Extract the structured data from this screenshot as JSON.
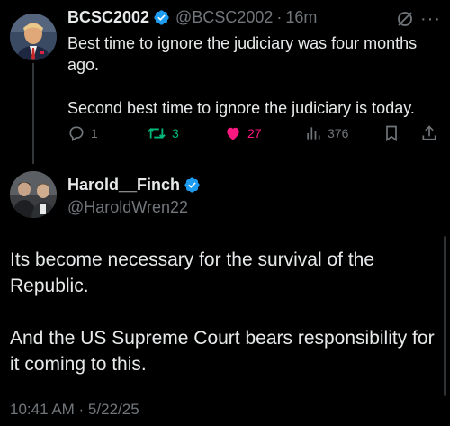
{
  "parent_tweet": {
    "display_name": "BCSC2002",
    "handle": "@BCSC2002",
    "separator": "·",
    "time": "16m",
    "paragraphs": [
      "Best time to ignore the judiciary was four months ago.",
      "Second best time to ignore the judiciary is today."
    ],
    "actions": {
      "reply_count": "1",
      "retweet_count": "3",
      "like_count": "27",
      "view_count": "376"
    },
    "icons": [
      "verified-badge-icon",
      "grok-icon",
      "more-icon",
      "reply-icon",
      "retweet-icon",
      "heart-icon",
      "views-icon",
      "bookmark-icon",
      "share-icon"
    ]
  },
  "main_tweet": {
    "display_name": "Harold__Finch",
    "handle": "@HaroldWren22",
    "paragraphs": [
      "Its become necessary for the survival of the Republic.",
      "And the US Supreme Court bears responsibility for it coming to this."
    ],
    "timestamp": "10:41 AM · 5/22/25"
  },
  "colors": {
    "background": "#000000",
    "text": "#e7e9ea",
    "muted": "#71767b",
    "verified": "#1d9bf0",
    "retweet": "#00ba7c",
    "like": "#f91880"
  }
}
